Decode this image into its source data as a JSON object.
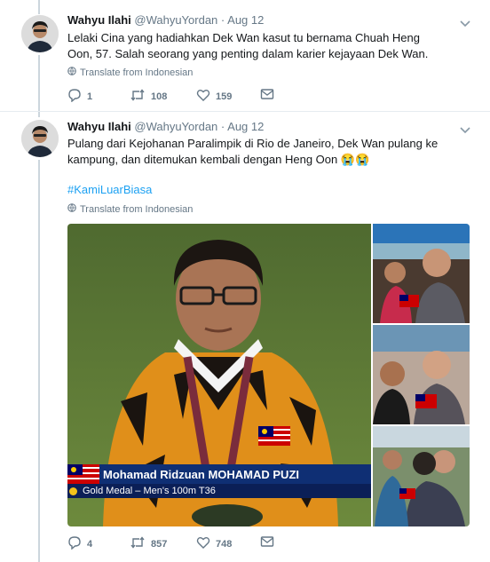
{
  "colors": {
    "accent": "#1da1f2",
    "secondary_text": "#657786",
    "primary_text": "#14171a",
    "thread_line": "#ccd6dd"
  },
  "tweets": [
    {
      "author_name": "Wahyu Ilahi",
      "author_handle": "@WahyuYordan",
      "separator": "·",
      "date": "Aug 12",
      "text": "Lelaki Cina yang hadiahkan Dek Wan kasut tu bernama Chuah Heng Oon, 57. Salah seorang yang penting dalam karier kejayaan Dek Wan.",
      "translate_label": "Translate from Indonesian",
      "replies": "1",
      "retweets": "108",
      "likes": "159"
    },
    {
      "author_name": "Wahyu Ilahi",
      "author_handle": "@WahyuYordan",
      "separator": "·",
      "date": "Aug 12",
      "text": "Pulang dari Kejohanan Paralimpik di Rio de Janeiro, Dek Wan pulang ke kampung, dan ditemukan kembali dengan Heng Oon 😭😭",
      "hashtag": "#KamiLuarBiasa",
      "translate_label": "Translate from Indonesian",
      "replies": "4",
      "retweets": "857",
      "likes": "748",
      "media": {
        "caption_name": "Mohamad Ridzuan MOHAMAD PUZI",
        "caption_medal": "Gold Medal – Men's 100m T36"
      }
    }
  ],
  "icons": {
    "avatar": "avatar",
    "caret": "chevron-down-icon",
    "globe": "globe-icon",
    "reply": "reply-icon",
    "retweet": "retweet-icon",
    "like": "heart-icon",
    "dm": "envelope-icon"
  }
}
